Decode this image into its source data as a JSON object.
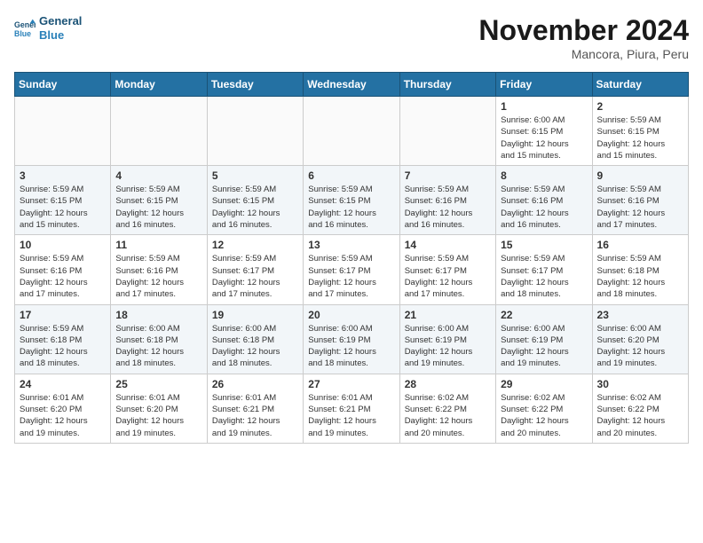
{
  "logo": {
    "line1": "General",
    "line2": "Blue"
  },
  "title": "November 2024",
  "subtitle": "Mancora, Piura, Peru",
  "weekdays": [
    "Sunday",
    "Monday",
    "Tuesday",
    "Wednesday",
    "Thursday",
    "Friday",
    "Saturday"
  ],
  "weeks": [
    [
      {
        "day": "",
        "info": ""
      },
      {
        "day": "",
        "info": ""
      },
      {
        "day": "",
        "info": ""
      },
      {
        "day": "",
        "info": ""
      },
      {
        "day": "",
        "info": ""
      },
      {
        "day": "1",
        "info": "Sunrise: 6:00 AM\nSunset: 6:15 PM\nDaylight: 12 hours\nand 15 minutes."
      },
      {
        "day": "2",
        "info": "Sunrise: 5:59 AM\nSunset: 6:15 PM\nDaylight: 12 hours\nand 15 minutes."
      }
    ],
    [
      {
        "day": "3",
        "info": "Sunrise: 5:59 AM\nSunset: 6:15 PM\nDaylight: 12 hours\nand 15 minutes."
      },
      {
        "day": "4",
        "info": "Sunrise: 5:59 AM\nSunset: 6:15 PM\nDaylight: 12 hours\nand 16 minutes."
      },
      {
        "day": "5",
        "info": "Sunrise: 5:59 AM\nSunset: 6:15 PM\nDaylight: 12 hours\nand 16 minutes."
      },
      {
        "day": "6",
        "info": "Sunrise: 5:59 AM\nSunset: 6:15 PM\nDaylight: 12 hours\nand 16 minutes."
      },
      {
        "day": "7",
        "info": "Sunrise: 5:59 AM\nSunset: 6:16 PM\nDaylight: 12 hours\nand 16 minutes."
      },
      {
        "day": "8",
        "info": "Sunrise: 5:59 AM\nSunset: 6:16 PM\nDaylight: 12 hours\nand 16 minutes."
      },
      {
        "day": "9",
        "info": "Sunrise: 5:59 AM\nSunset: 6:16 PM\nDaylight: 12 hours\nand 17 minutes."
      }
    ],
    [
      {
        "day": "10",
        "info": "Sunrise: 5:59 AM\nSunset: 6:16 PM\nDaylight: 12 hours\nand 17 minutes."
      },
      {
        "day": "11",
        "info": "Sunrise: 5:59 AM\nSunset: 6:16 PM\nDaylight: 12 hours\nand 17 minutes."
      },
      {
        "day": "12",
        "info": "Sunrise: 5:59 AM\nSunset: 6:17 PM\nDaylight: 12 hours\nand 17 minutes."
      },
      {
        "day": "13",
        "info": "Sunrise: 5:59 AM\nSunset: 6:17 PM\nDaylight: 12 hours\nand 17 minutes."
      },
      {
        "day": "14",
        "info": "Sunrise: 5:59 AM\nSunset: 6:17 PM\nDaylight: 12 hours\nand 17 minutes."
      },
      {
        "day": "15",
        "info": "Sunrise: 5:59 AM\nSunset: 6:17 PM\nDaylight: 12 hours\nand 18 minutes."
      },
      {
        "day": "16",
        "info": "Sunrise: 5:59 AM\nSunset: 6:18 PM\nDaylight: 12 hours\nand 18 minutes."
      }
    ],
    [
      {
        "day": "17",
        "info": "Sunrise: 5:59 AM\nSunset: 6:18 PM\nDaylight: 12 hours\nand 18 minutes."
      },
      {
        "day": "18",
        "info": "Sunrise: 6:00 AM\nSunset: 6:18 PM\nDaylight: 12 hours\nand 18 minutes."
      },
      {
        "day": "19",
        "info": "Sunrise: 6:00 AM\nSunset: 6:18 PM\nDaylight: 12 hours\nand 18 minutes."
      },
      {
        "day": "20",
        "info": "Sunrise: 6:00 AM\nSunset: 6:19 PM\nDaylight: 12 hours\nand 18 minutes."
      },
      {
        "day": "21",
        "info": "Sunrise: 6:00 AM\nSunset: 6:19 PM\nDaylight: 12 hours\nand 19 minutes."
      },
      {
        "day": "22",
        "info": "Sunrise: 6:00 AM\nSunset: 6:19 PM\nDaylight: 12 hours\nand 19 minutes."
      },
      {
        "day": "23",
        "info": "Sunrise: 6:00 AM\nSunset: 6:20 PM\nDaylight: 12 hours\nand 19 minutes."
      }
    ],
    [
      {
        "day": "24",
        "info": "Sunrise: 6:01 AM\nSunset: 6:20 PM\nDaylight: 12 hours\nand 19 minutes."
      },
      {
        "day": "25",
        "info": "Sunrise: 6:01 AM\nSunset: 6:20 PM\nDaylight: 12 hours\nand 19 minutes."
      },
      {
        "day": "26",
        "info": "Sunrise: 6:01 AM\nSunset: 6:21 PM\nDaylight: 12 hours\nand 19 minutes."
      },
      {
        "day": "27",
        "info": "Sunrise: 6:01 AM\nSunset: 6:21 PM\nDaylight: 12 hours\nand 19 minutes."
      },
      {
        "day": "28",
        "info": "Sunrise: 6:02 AM\nSunset: 6:22 PM\nDaylight: 12 hours\nand 20 minutes."
      },
      {
        "day": "29",
        "info": "Sunrise: 6:02 AM\nSunset: 6:22 PM\nDaylight: 12 hours\nand 20 minutes."
      },
      {
        "day": "30",
        "info": "Sunrise: 6:02 AM\nSunset: 6:22 PM\nDaylight: 12 hours\nand 20 minutes."
      }
    ]
  ]
}
